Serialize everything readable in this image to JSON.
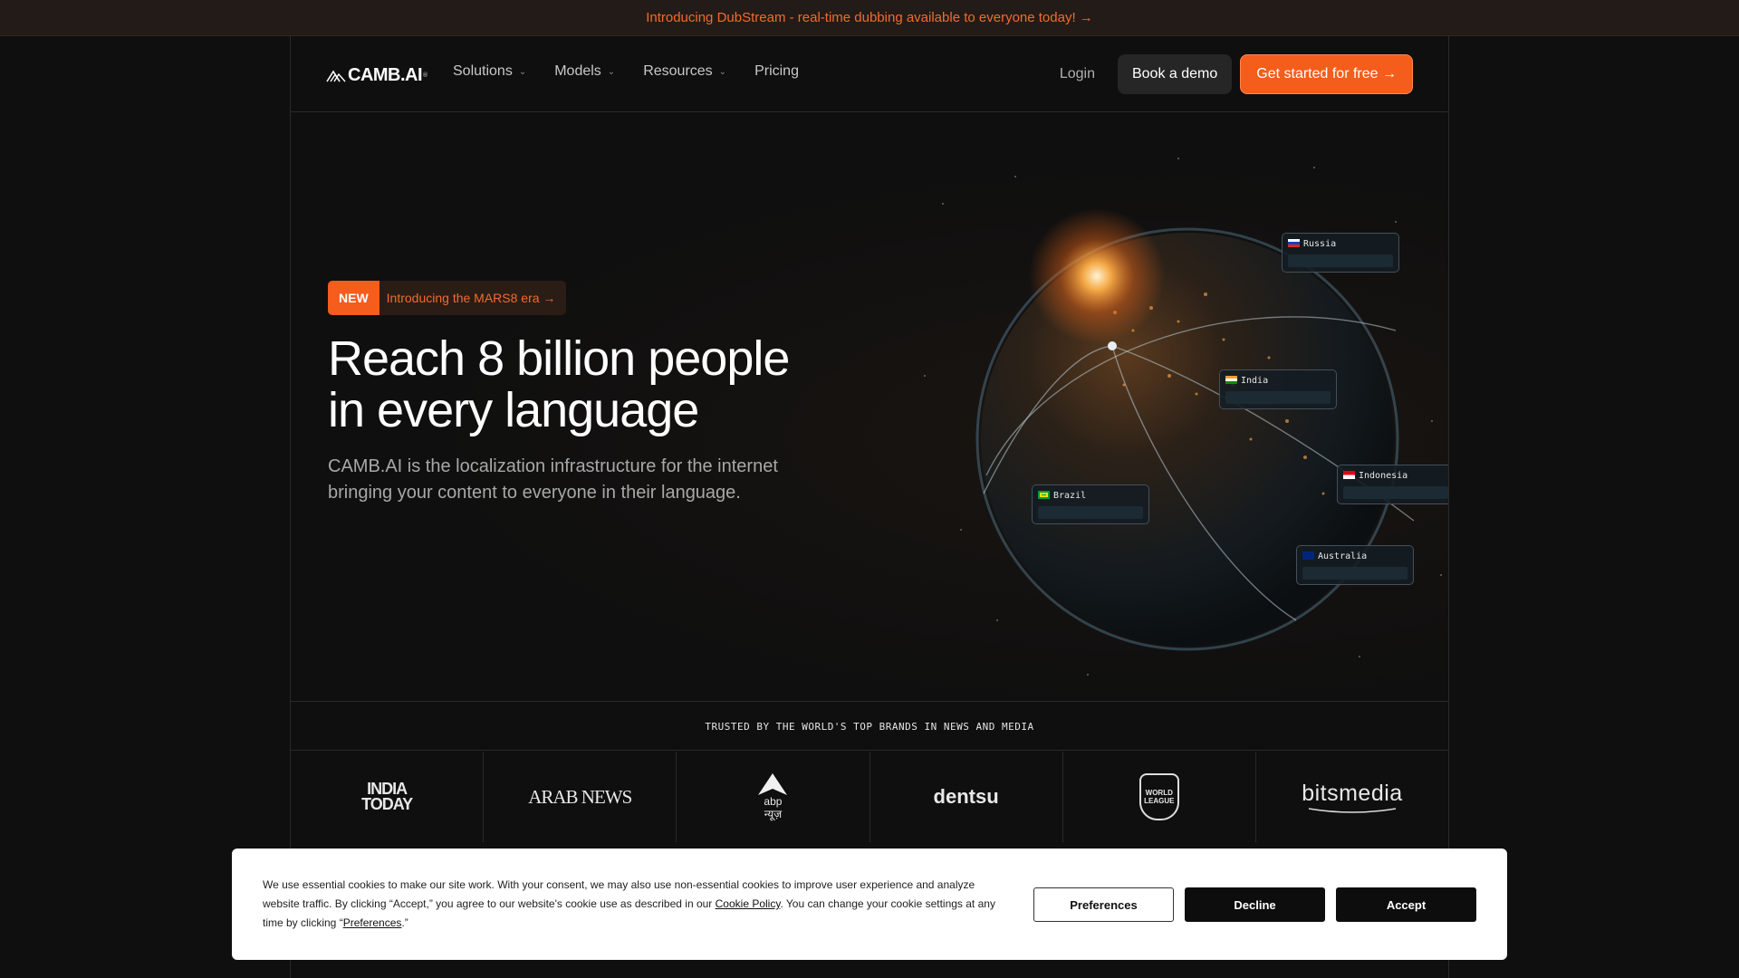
{
  "announcement": "Introducing DubStream - real-time dubbing available to everyone today! →",
  "nav": {
    "logo": "CAMB.AI",
    "menu": [
      {
        "label": "Solutions",
        "dropdown": true
      },
      {
        "label": "Models",
        "dropdown": true
      },
      {
        "label": "Resources",
        "dropdown": true
      },
      {
        "label": "Pricing",
        "dropdown": false
      }
    ],
    "login": "Login",
    "book_demo": "Book a demo",
    "get_started": "Get started for free →"
  },
  "hero": {
    "badge_new": "NEW",
    "badge_text": "Introducing the MARS8 era →",
    "headline_line1": "Reach 8 billion people",
    "headline_line2": "in every language",
    "subtext_line1": "CAMB.AI is the localization infrastructure for the internet",
    "subtext_line2": "bringing your content to everyone in their language."
  },
  "globe_tags": [
    {
      "label": "Russia"
    },
    {
      "label": "India"
    },
    {
      "label": "Indonesia"
    },
    {
      "label": "Brazil"
    },
    {
      "label": "Australia"
    }
  ],
  "trusted": {
    "title": "TRUSTED BY THE WORLD'S TOP BRANDS IN NEWS AND MEDIA",
    "logos": [
      {
        "name": "INDIA TODAY"
      },
      {
        "name": "ARAB NEWS"
      },
      {
        "name": "abp न्यूज़"
      },
      {
        "name": "dentsu"
      },
      {
        "name": "WORLD LEAGUE"
      },
      {
        "name": "bitsmedia"
      }
    ]
  },
  "cookie": {
    "text_before_link": "We use essential cookies to make our site work. With your consent, we may also use non-essential cookies to improve user experience and analyze website traffic. By clicking “Accept,” you agree to our website's cookie use as described in our ",
    "policy_link": "Cookie Policy",
    "text_middle": ". You can change your cookie settings at any time by clicking “",
    "preferences_link": "Preferences",
    "text_end": ".”",
    "preferences_button": "Preferences",
    "decline_button": "Decline",
    "accept_button": "Accept"
  },
  "colors": {
    "accent": "#f45d1b",
    "background": "#0f0f0f",
    "announcement_bg": "#231b17"
  }
}
